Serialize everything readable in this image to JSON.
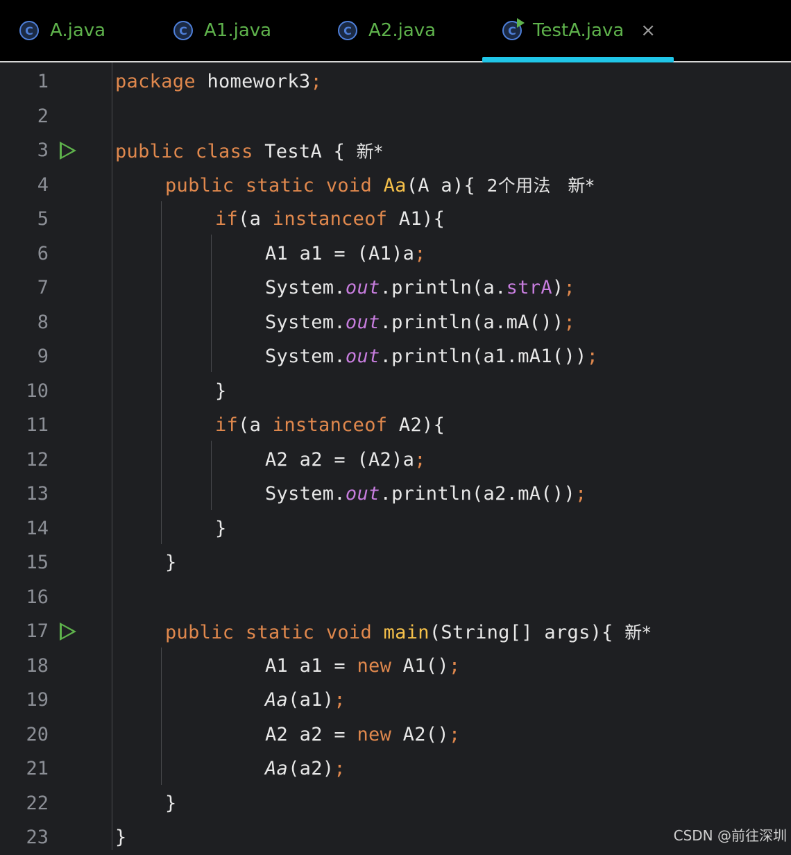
{
  "tabs": [
    {
      "label": "A.java",
      "icon": "class-icon",
      "active": false
    },
    {
      "label": "A1.java",
      "icon": "class-icon",
      "active": false
    },
    {
      "label": "A2.java",
      "icon": "class-icon",
      "active": false
    },
    {
      "label": "TestA.java",
      "icon": "runnable-class-icon",
      "active": true
    }
  ],
  "tab_close": "×",
  "colors": {
    "accent": "#20c6e8",
    "keyword": "#e0884d",
    "method": "#f5c04a",
    "field": "#c77dde",
    "run": "#5fb34c"
  },
  "line_numbers": [
    "1",
    "2",
    "3",
    "4",
    "5",
    "6",
    "7",
    "8",
    "9",
    "10",
    "11",
    "12",
    "13",
    "14",
    "15",
    "16",
    "17",
    "18",
    "19",
    "20",
    "21",
    "22",
    "23"
  ],
  "code": {
    "l1": [
      "package",
      " homework3",
      ";"
    ],
    "l3": [
      "public",
      " ",
      "class",
      " TestA {",
      "  新*"
    ],
    "l4": [
      "public",
      " ",
      "static",
      " ",
      "void",
      " ",
      "Aa",
      "(A a){",
      "  2个用法   新*"
    ],
    "l5": [
      "if",
      "(a ",
      "instanceof",
      " A1){"
    ],
    "l6": [
      "A1 a1 = (A1)a",
      ";"
    ],
    "l7": [
      "System.",
      "out",
      ".println(a.",
      "strA",
      ")",
      ";"
    ],
    "l8": [
      "System.",
      "out",
      ".println(a.mA())",
      ";"
    ],
    "l9": [
      "System.",
      "out",
      ".println(a1.mA1())",
      ";"
    ],
    "l10": [
      "}"
    ],
    "l11": [
      "if",
      "(a ",
      "instanceof",
      " A2){"
    ],
    "l12": [
      "A2 a2 = (A2)a",
      ";"
    ],
    "l13": [
      "System.",
      "out",
      ".println(a2.mA())",
      ";"
    ],
    "l14": [
      "}"
    ],
    "l15": [
      "}"
    ],
    "l17": [
      "public",
      " ",
      "static",
      " ",
      "void",
      " ",
      "main",
      "(String[] args){",
      "  新*"
    ],
    "l18": [
      "A1 a1 = ",
      "new",
      " A1()",
      ";"
    ],
    "l19": [
      "Aa",
      "(a1)",
      ";"
    ],
    "l20": [
      "A2 a2 = ",
      "new",
      " A2()",
      ";"
    ],
    "l21": [
      "Aa",
      "(a2)",
      ";"
    ],
    "l22": [
      "}"
    ],
    "l23": [
      "}"
    ]
  },
  "watermark": "CSDN @前往深圳"
}
